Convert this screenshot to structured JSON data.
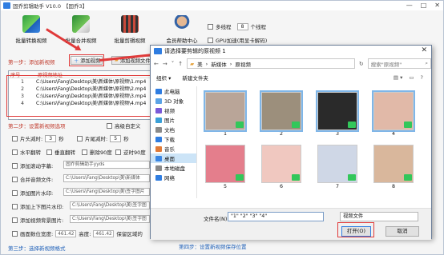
{
  "app": {
    "title": "固乔剪辑助手 V10.0",
    "tag": "【固乔3】",
    "window_buttons": [
      "—",
      "□",
      "✕"
    ],
    "tools": [
      {
        "label": "批量转换视频",
        "icon": "convert-video-icon"
      },
      {
        "label": "批量合并视频",
        "icon": "merge-video-icon"
      },
      {
        "label": "批量剪辑视频",
        "icon": "cut-video-icon"
      },
      {
        "label": "会员帮助中心",
        "icon": "member-center-icon"
      }
    ],
    "options": {
      "multithread": "多线程",
      "thread_count": "8",
      "thread_unit": "个线程",
      "gpu": "GPU加速(用显卡解码)"
    },
    "step1": {
      "label": "第一步：添加新视频",
      "add_video": "添加视频",
      "add_folder": "添加视频文件夹"
    },
    "list": {
      "headers": [
        "序号",
        "原视频地址"
      ],
      "rows": [
        {
          "num": "1",
          "path": "C:\\Users\\Fang\\Desktop\\美\\新媒体\\原视频\\1.mp4"
        },
        {
          "num": "2",
          "path": "C:\\Users\\Fang\\Desktop\\美\\新媒体\\原视频\\2.mp4"
        },
        {
          "num": "3",
          "path": "C:\\Users\\Fang\\Desktop\\美\\新媒体\\原视频\\3.mp4"
        },
        {
          "num": "4",
          "path": "C:\\Users\\Fang\\Desktop\\美\\新媒体\\原视频\\4.mp4"
        }
      ]
    },
    "step2": {
      "label": "第二步：设置新视频选项",
      "advanced": "高级自定义",
      "head_cut": "片头减时:",
      "head_val": "3",
      "tail_cut": "片尾减时:",
      "tail_val": "5",
      "sec": "秒",
      "row2": [
        "水平翻转",
        "垂直翻转",
        "删除90度",
        "逆时90度"
      ],
      "add_subtitle": "添加滚动字幕:",
      "subtitle_val": "固乔剪辑助手yyds",
      "merge_audio": "合并音频文件:",
      "merge_audio_val": "C:\\Users\\Fang\\Desktop\\美\\新媒体",
      "add_image": "添加图片水印:",
      "add_image_val": "C:\\Users\\Fang\\Desktop\\美\\签字图片",
      "add_top_bottom": "添加上下图片水印:",
      "add_top_bottom_val": "C:\\Users\\Fang\\Desktop\\美\\签字图",
      "add_bg_image": "添加视频背景图片:",
      "add_bg_image_val": "C:\\Users\\Fang\\Desktop\\美\\签字图",
      "canvas_width": "画面数位宽度:",
      "canvas_width_val": "461.42",
      "height": "高度:",
      "height_val": "461.42",
      "keep_area": "保留区域的"
    },
    "step3": "第三步：选择新视频格式",
    "step4": "第四步：设置新视频保存位置"
  },
  "dialog": {
    "title": "请选择要剪辑的原视频 1",
    "close": "✕",
    "breadcrumb": [
      "美",
      "新媒体",
      "原视频"
    ],
    "refresh": "↻",
    "search_placeholder": "搜索\"原视频\"",
    "organize": "组织 ▾",
    "new_folder": "新建文件夹",
    "nav_items": [
      {
        "label": "此电脑",
        "icon": "computer-icon"
      },
      {
        "label": "3D 对象",
        "icon": "3d-objects-icon"
      },
      {
        "label": "视频",
        "icon": "videos-icon"
      },
      {
        "label": "图片",
        "icon": "pictures-icon"
      },
      {
        "label": "文档",
        "icon": "documents-icon"
      },
      {
        "label": "下载",
        "icon": "downloads-icon"
      },
      {
        "label": "音乐",
        "icon": "music-icon"
      },
      {
        "label": "桌面",
        "icon": "desktop-icon"
      },
      {
        "label": "本地磁盘",
        "icon": "local-disk-icon"
      },
      {
        "label": "网络",
        "icon": "network-icon"
      }
    ],
    "thumbnails": [
      {
        "label": "1",
        "selected": true,
        "color": "#b9a598"
      },
      {
        "label": "2",
        "selected": true,
        "color": "#9c8f7c"
      },
      {
        "label": "3",
        "selected": true,
        "color": "#2a2a2a"
      },
      {
        "label": "4",
        "selected": true,
        "color": "#e1b9a8"
      },
      {
        "label": "5",
        "selected": false,
        "color": "#e47e8c"
      },
      {
        "label": "6",
        "selected": false,
        "color": "#f0c8c0"
      },
      {
        "label": "7",
        "selected": false,
        "color": "#cfd7e6"
      },
      {
        "label": "8",
        "selected": false,
        "color": "#d9b79c"
      }
    ],
    "filename_label": "文件名(N):",
    "filename_value": "\"1\" \"2\" \"3\" \"4\"",
    "filetype": "视频文件",
    "open_button": "打开(O)",
    "cancel_button": "取消"
  },
  "colors": {
    "accent": "#2f7de1",
    "annotation_red": "#e03a3a",
    "play_badge": "#32c75a"
  }
}
